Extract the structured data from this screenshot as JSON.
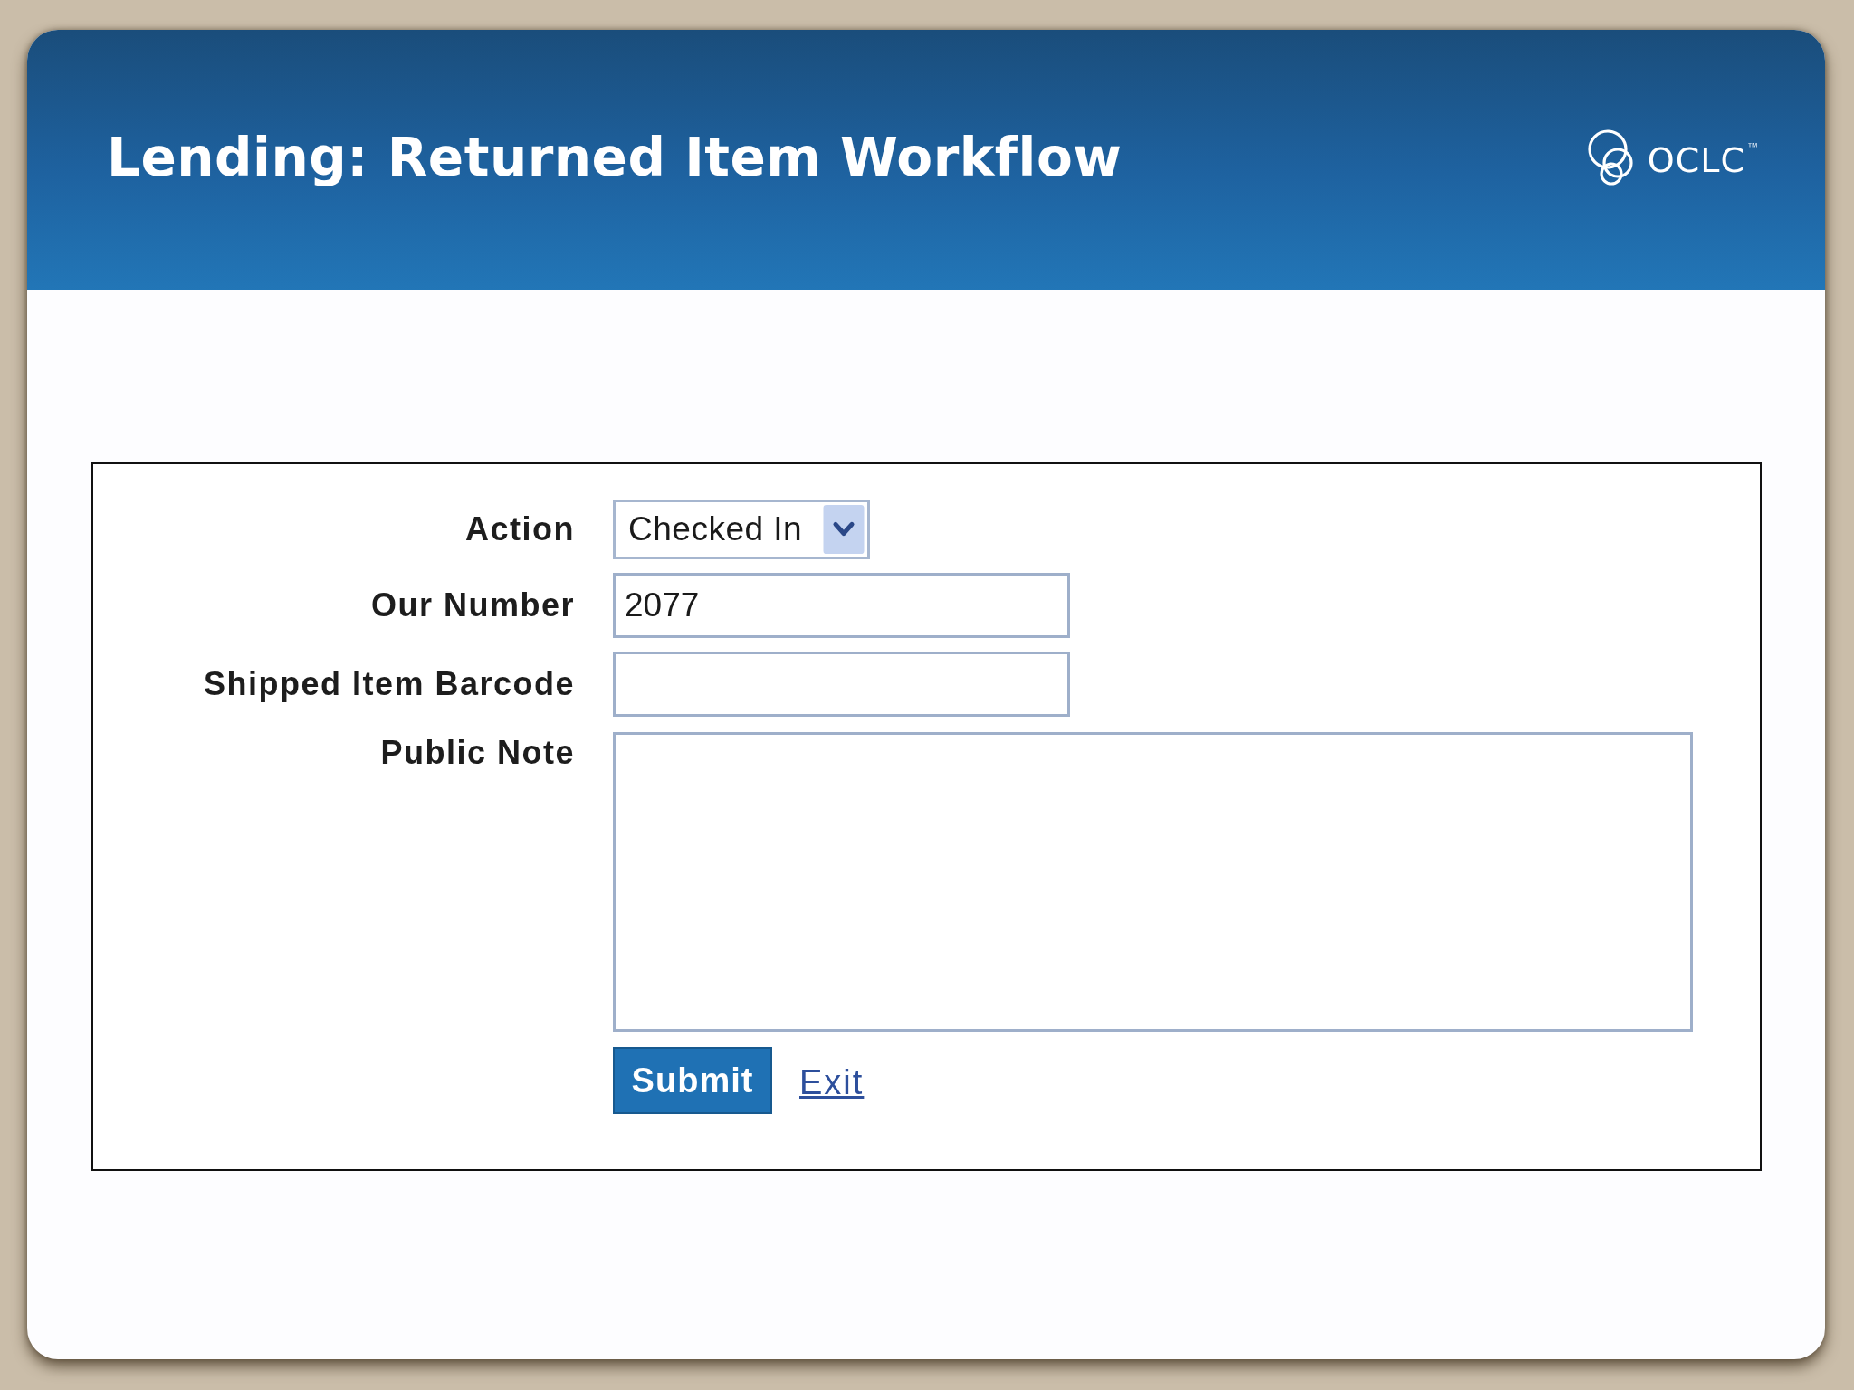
{
  "header": {
    "title": "Lending: Returned Item Workflow",
    "logo": {
      "wordmark": "OCLC",
      "trademark": "™"
    }
  },
  "form": {
    "fields": [
      {
        "kind": "select",
        "label": "Action",
        "value": "Checked In"
      },
      {
        "kind": "text",
        "label": "Our Number",
        "value": "2077"
      },
      {
        "kind": "text",
        "label": "Shipped Item Barcode"
      },
      {
        "kind": "textarea",
        "label": "Public Note"
      }
    ],
    "actions": [
      {
        "kind": "button",
        "label": "Submit"
      },
      {
        "kind": "link",
        "label": "Exit"
      }
    ]
  }
}
